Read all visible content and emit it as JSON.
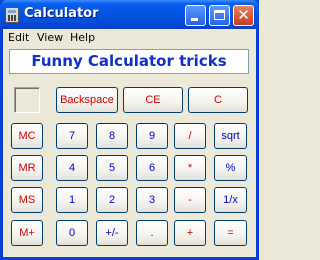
{
  "window": {
    "title": "Calculator",
    "minimize_icon": "minimize-icon",
    "maximize_icon": "maximize-icon",
    "close_icon": "close-icon",
    "close_glyph": "✕"
  },
  "menu": {
    "edit": "Edit",
    "view": "View",
    "help": "Help"
  },
  "display": {
    "text": "Funny Calculator tricks"
  },
  "colors": {
    "display_text": "#1030c8",
    "operator_text": "#d50000",
    "digit_text": "#0000c8",
    "titlebar": "#0453e3",
    "close_button": "#c93d1c"
  },
  "buttons": {
    "backspace": "Backspace",
    "ce": "CE",
    "c": "C",
    "mc": "MC",
    "mr": "MR",
    "ms": "MS",
    "mplus": "M+",
    "d7": "7",
    "d8": "8",
    "d9": "9",
    "div": "/",
    "sqrt": "sqrt",
    "d4": "4",
    "d5": "5",
    "d6": "6",
    "mul": "*",
    "pct": "%",
    "d1": "1",
    "d2": "2",
    "d3": "3",
    "sub": "-",
    "inv": "1/x",
    "d0": "0",
    "sign": "+/-",
    "dot": ".",
    "add": "+",
    "eq": "="
  }
}
